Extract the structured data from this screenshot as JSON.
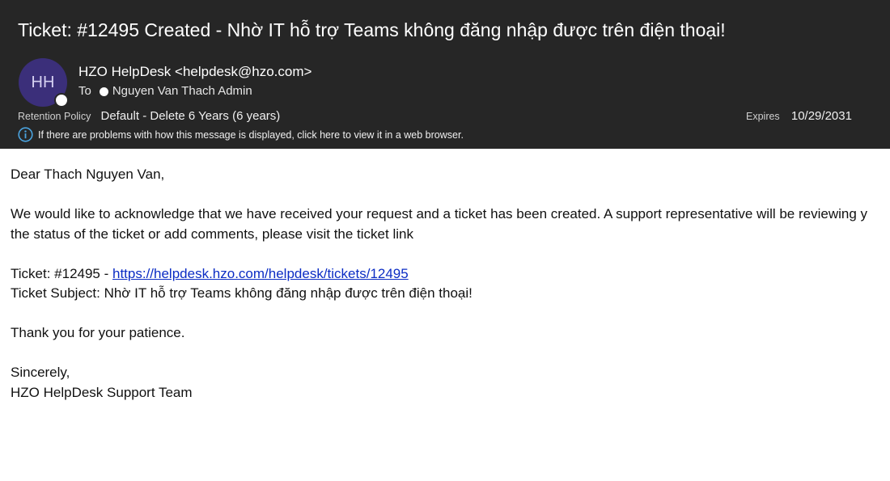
{
  "header": {
    "subject": "Ticket: #12495 Created - Nhờ IT hỗ trợ Teams không đăng nhập được trên điện thoại!",
    "avatar_initials": "HH",
    "sender": "HZO HelpDesk <helpdesk@hzo.com>",
    "to_label": "To",
    "recipient": "Nguyen Van Thach Admin",
    "retention_label": "Retention Policy",
    "retention_value": "Default - Delete 6 Years (6 years)",
    "expires_label": "Expires",
    "expires_value": "10/29/2031",
    "info_text": "If there are problems with how this message is displayed, click here to view it in a web browser.",
    "icons": [
      "info-icon",
      "presence-icon"
    ]
  },
  "body": {
    "greeting": "Dear Thach Nguyen Van,",
    "ack_line1": "We would like to acknowledge that we have received your request and a ticket has been created. A support representative will be reviewing y",
    "ack_line2": "the status of the ticket or add comments, please visit the ticket link",
    "ticket_prefix": "Ticket: #12495 - ",
    "ticket_link": "https://helpdesk.hzo.com/helpdesk/tickets/12495",
    "ticket_subject": "Ticket Subject: Nhờ IT hỗ trợ Teams không đăng nhập được trên điện thoại!",
    "thanks": "Thank you for your patience.",
    "closing": "Sincerely,",
    "signature": "HZO HelpDesk Support Team"
  },
  "colors": {
    "header_bg": "#262626",
    "avatar_bg": "#3b2f7a",
    "link": "#0b2cc4",
    "info_icon": "#4aa3df"
  }
}
